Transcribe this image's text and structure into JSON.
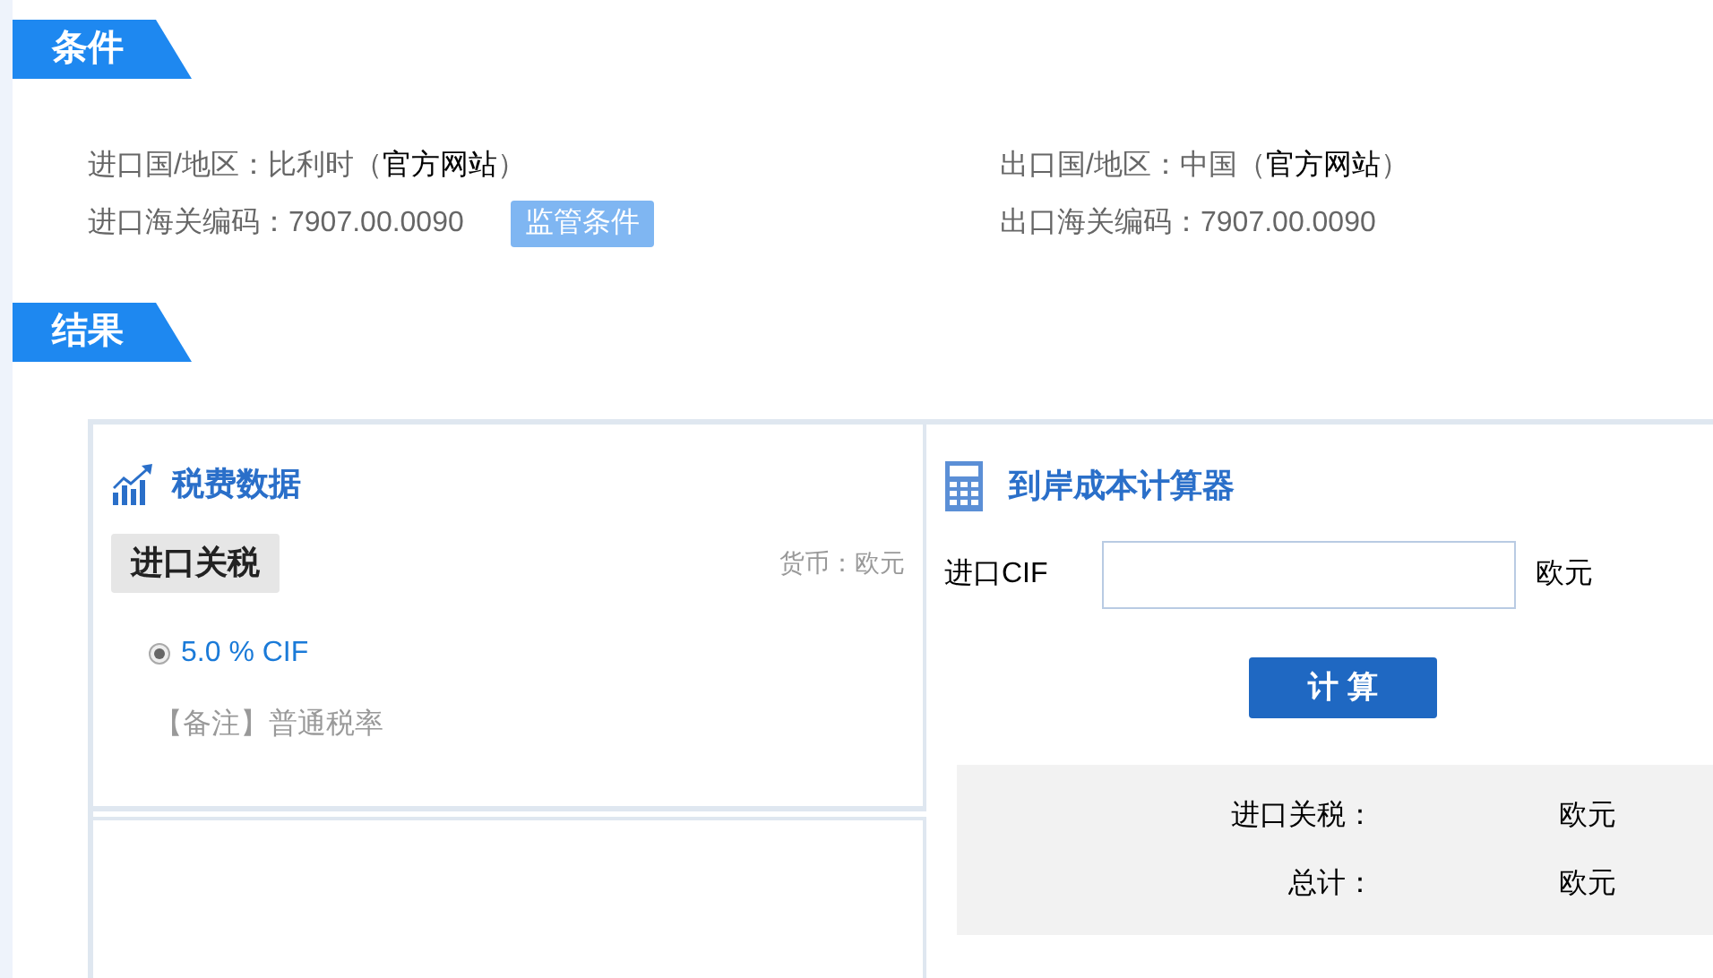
{
  "sections": [
    {
      "title": "条件"
    },
    {
      "title": "结果"
    }
  ],
  "conditions": {
    "left": [
      {
        "text": "进口国/地区：比利时（",
        "link": "官方网站",
        "after": "）"
      },
      {
        "text": "进口海关编码：7907.00.0090",
        "badge": "监管条件"
      }
    ],
    "right": [
      {
        "text": "出口国/地区：中国（",
        "link": "官方网站",
        "after": "）"
      },
      {
        "text": "出口海关编码：7907.00.0090"
      }
    ]
  },
  "tax_panel": {
    "title": "税费数据",
    "tab": "进口关税",
    "currency": "货币：欧元",
    "rates": [
      {
        "text": "5.0 % CIF",
        "selected": true
      }
    ],
    "note": "【备注】普通税率"
  },
  "calculator": {
    "title": "到岸成本计算器",
    "cif_label": "进口CIF",
    "unit": "欧元",
    "button": "计 算",
    "results": [
      {
        "label": "进口关税：",
        "unit": "欧元"
      },
      {
        "label": "总计：",
        "unit": "欧元"
      }
    ]
  }
}
